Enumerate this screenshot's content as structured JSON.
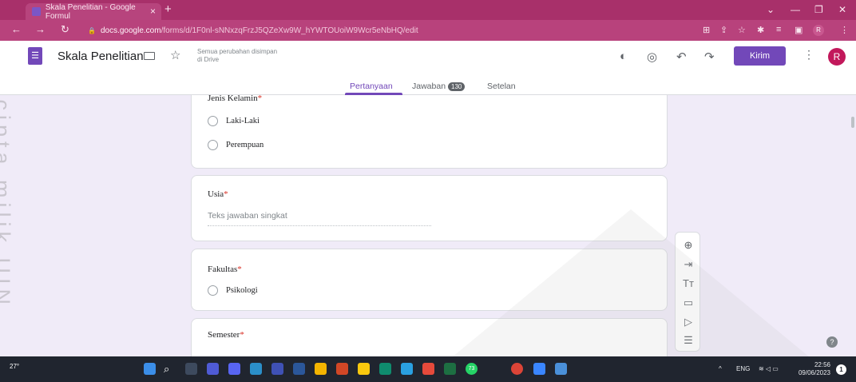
{
  "browser": {
    "tab_title": "Skala Penelitian - Google Formul",
    "tab_close": "×",
    "new_tab": "+",
    "url_host": "docs.google.com",
    "url_path": "/forms/d/1F0nl-sNNxzqFrzJ5QZeXw9W_hYWTOUoiW9Wcr5eNbHQ/edit",
    "profile_initial": "R"
  },
  "header": {
    "title": "Skala Penelitian",
    "save_status_line1": "Semua perubahan disimpan",
    "save_status_line2": "di Drive",
    "send_label": "Kirim",
    "avatar_initial": "R"
  },
  "tabs": {
    "questions": "Pertanyaan",
    "responses": "Jawaban",
    "responses_count": "130",
    "settings": "Setelan"
  },
  "questions": [
    {
      "title": "Jenis Kelamin",
      "required": "*",
      "options": [
        "Laki-Laki",
        "Perempuan"
      ]
    },
    {
      "title": "Usia",
      "required": "*",
      "placeholder": "Teks jawaban singkat"
    },
    {
      "title": "Fakultas",
      "required": "*",
      "options": [
        "Psikologi"
      ]
    },
    {
      "title": "Semester",
      "required": "*"
    }
  ],
  "watermark": "Hak cipta milik UIN Sus",
  "taskbar": {
    "weather": "27°",
    "lang": "ENG",
    "time": "22:56",
    "date": "09/06/2023",
    "notification_count": "1",
    "chrome_badge": "73"
  },
  "colors": {
    "browser_accent": "#a8306a",
    "forms_purple": "#7248b9",
    "page_bg": "#f0ebf8",
    "required_red": "#d93025"
  },
  "icons": [
    "palette-icon",
    "preview-eye-icon",
    "undo-icon",
    "redo-icon",
    "add-question-icon",
    "import-questions-icon",
    "add-title-icon",
    "add-image-icon",
    "add-video-icon",
    "add-section-icon",
    "help-icon"
  ]
}
